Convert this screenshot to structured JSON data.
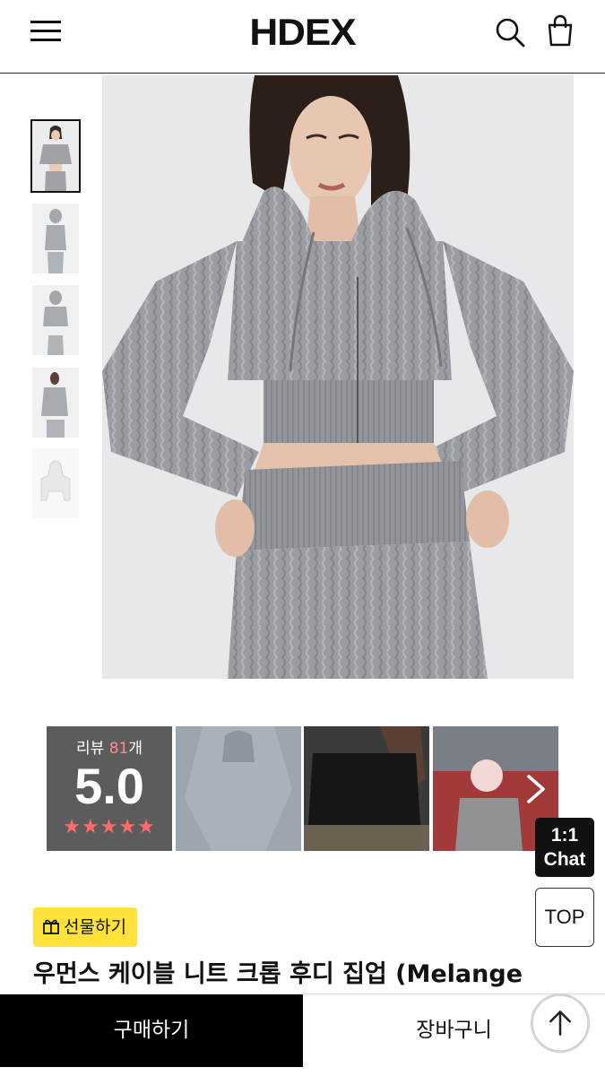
{
  "header": {
    "logo": "HDEX"
  },
  "thumbnails": [
    {
      "alt": "thumb-1"
    },
    {
      "alt": "thumb-2"
    },
    {
      "alt": "thumb-3"
    },
    {
      "alt": "thumb-4"
    },
    {
      "alt": "thumb-5"
    }
  ],
  "reviews": {
    "label": "리뷰 ",
    "count": "81",
    "count_suffix": "개",
    "score": "5.0",
    "stars": "★★★★★",
    "rating_stars": 5
  },
  "floating": {
    "chat_line1": "1:1",
    "chat_line2": "Chat",
    "top_label": "TOP"
  },
  "product": {
    "gift_label": "선물하기",
    "title": "우먼스 케이블 니트 크롭 후디 집업 (Melange"
  },
  "bottom_bar": {
    "buy_label": "구매하기",
    "cart_label": "장바구니"
  },
  "colors": {
    "accent_yellow": "#ffe13a",
    "star_pink": "#ff6b6b",
    "primary_black": "#000000"
  }
}
